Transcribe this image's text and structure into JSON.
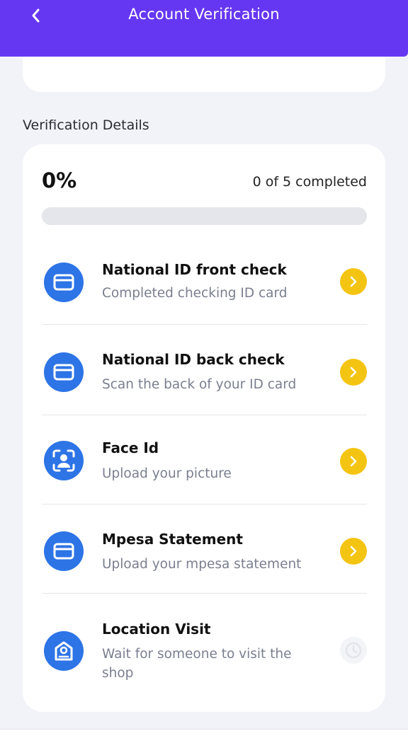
{
  "header": {
    "title": "Account Verification"
  },
  "section_title": "Verification Details",
  "progress": {
    "percent_label": "0%",
    "count_label": "0 of 5 completed",
    "fraction": 0
  },
  "steps": [
    {
      "title": "National ID front check",
      "subtitle": "Completed checking ID card",
      "icon": "id-card-icon",
      "status": "action"
    },
    {
      "title": "National ID back check",
      "subtitle": "Scan the back of your ID card",
      "icon": "id-card-icon",
      "status": "action"
    },
    {
      "title": "Face Id",
      "subtitle": "Upload your picture",
      "icon": "face-scan-icon",
      "status": "action"
    },
    {
      "title": "Mpesa Statement",
      "subtitle": "Upload your mpesa statement",
      "icon": "id-card-icon",
      "status": "action"
    },
    {
      "title": "Location Visit",
      "subtitle": "Wait for someone to visit the shop",
      "icon": "shop-location-icon",
      "status": "pending"
    }
  ],
  "colors": {
    "header": "#6637f2",
    "icon_bg": "#2d74e6",
    "action": "#f4c412",
    "pending": "#f3f4f7"
  }
}
